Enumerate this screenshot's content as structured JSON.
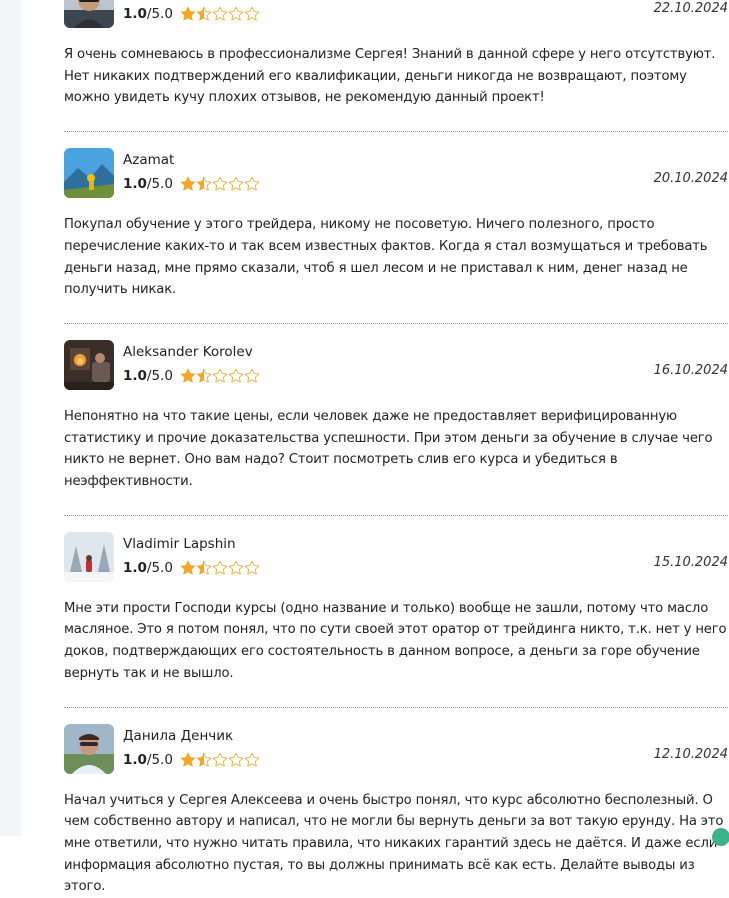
{
  "rating_max_label": "/5.0",
  "colors": {
    "star": "#f5a623",
    "accent": "#3bb38a"
  },
  "reviews": [
    {
      "author": "",
      "score": "1.0",
      "stars_filled": 1.5,
      "date": "22.10.2024",
      "avatar_icon": "man-in-sunglasses-avatar",
      "text": "Я очень сомневаюсь в профессионализме Сергея! Знаний в данной сфере у него отсутствуют. Нет никаких подтверждений его квалификации, деньги никогда не возвращают, поэтому можно увидеть кучу плохих отзывов, не рекомендую данный проект!"
    },
    {
      "author": "Azamat",
      "score": "1.0",
      "stars_filled": 1.5,
      "date": "20.10.2024",
      "avatar_icon": "mountain-landscape-avatar",
      "text": "Покупал обучение у этого трейдера, никому не посоветую. Ничего полезного, просто перечисление каких-то и так всем известных фактов. Когда я стал возмущаться и требовать деньги назад, мне прямо сказали, чтоб я шел лесом и не приставал к ним, денег назад не получить никак."
    },
    {
      "author": "Aleksander Korolev",
      "score": "1.0",
      "stars_filled": 1.5,
      "date": "16.10.2024",
      "avatar_icon": "fireplace-room-avatar",
      "text": "Непонятно на что такие цены, если человек даже не предоставляет верифицированную статистику и прочие доказательства успешности. При этом деньги за обучение в случае чего никто не вернет. Оно вам надо? Стоит посмотреть слив его курса и убедиться в неэффективности."
    },
    {
      "author": "Vladimir Lapshin",
      "score": "1.0",
      "stars_filled": 1.5,
      "date": "15.10.2024",
      "avatar_icon": "snowy-forest-avatar",
      "text": "Мне эти прости Господи курсы (одно название и только) вообще не зашли, потому что масло масляное. Это я потом понял, что по сути своей этот оратор от трейдинга никто, т.к. нет у него доков, подтверждающих его состоятельность в данном вопросе, а деньги за горе обучение вернуть так и не вышло."
    },
    {
      "author": "Данила Денчик",
      "score": "1.0",
      "stars_filled": 1.5,
      "date": "12.10.2024",
      "avatar_icon": "man-portrait-avatar",
      "text": "Начал учиться у Сергея Алексеева и очень быстро понял, что курс абсолютно бесполезный. О чем собственно автору и написал, что не могли бы вернуть деньги за вот такую ерунду. На это мне ответили, что нужно читать правила, что никаких гарантий здесь не даётся. И даже если информация абсолютно пустая, то вы должны принимать всё как есть. Делайте выводы из этого."
    }
  ]
}
